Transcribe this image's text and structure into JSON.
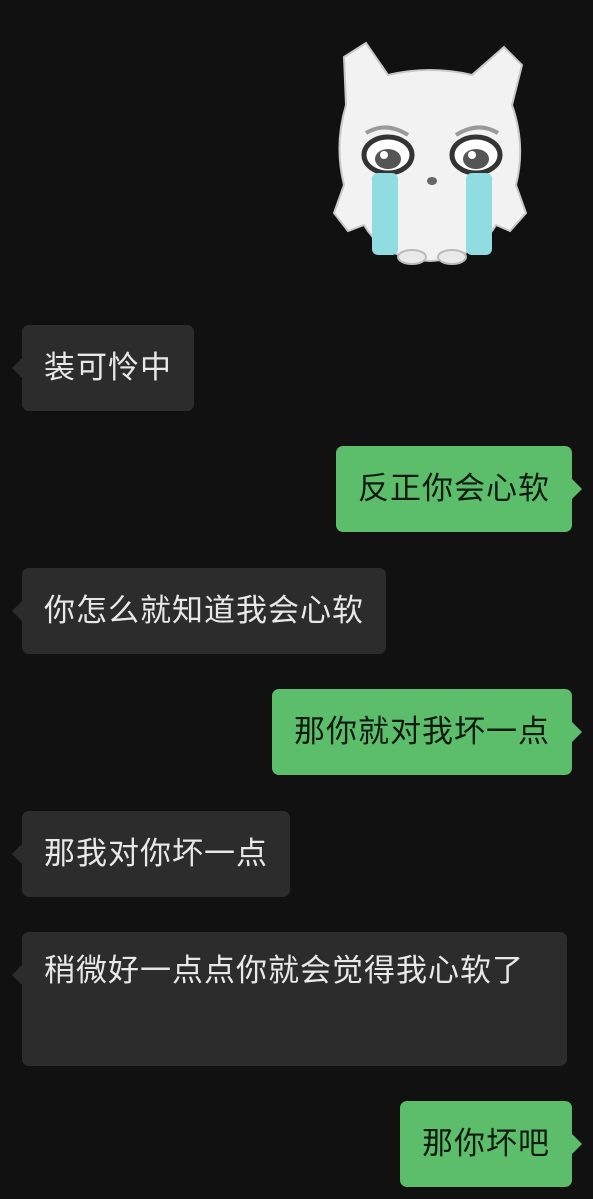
{
  "messages": [
    {
      "side": "left",
      "text": "装可怜中"
    },
    {
      "side": "right",
      "text": "反正你会心软"
    },
    {
      "side": "left",
      "text": "你怎么就知道我会心软"
    },
    {
      "side": "right",
      "text": "那你就对我坏一点"
    },
    {
      "side": "left",
      "text": "那我对你坏一点"
    },
    {
      "side": "left",
      "text": "稍微好一点点你就会觉得我心软了"
    },
    {
      "side": "right",
      "text": "那你坏吧"
    }
  ],
  "sticker": {
    "icon": "crying-cat-sticker-icon"
  },
  "colors": {
    "background": "#111111",
    "incoming_bubble": "#2c2c2c",
    "outgoing_bubble": "#5cbd6b"
  }
}
